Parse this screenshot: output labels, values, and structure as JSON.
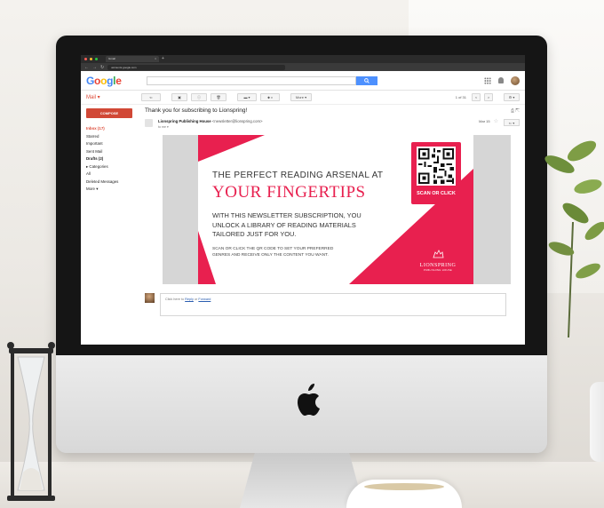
{
  "browser": {
    "tab_title": "Gmail",
    "tab_close": "×",
    "new_tab": "+",
    "url": "accounts.google.com"
  },
  "gmail": {
    "logo": [
      "G",
      "o",
      "o",
      "g",
      "l",
      "e"
    ],
    "mail_label": "Mail ▾",
    "toolbar": {
      "back": "⇐",
      "archive": "▣",
      "spam": "ⓘ",
      "delete": "🗑",
      "move": "▬ ▾",
      "labels": "⬥ ▾",
      "more": "More ▾",
      "page_count": "1 of 31",
      "prev": "<",
      "next": ">",
      "settings": "⚙ ▾"
    },
    "sidebar": {
      "compose": "COMPOSE",
      "items": [
        {
          "label": "Inbox (17)"
        },
        {
          "label": "Starred"
        },
        {
          "label": "Important"
        },
        {
          "label": "Sent Mail"
        },
        {
          "label": "Drafts (2)"
        },
        {
          "label": "▸ Categories"
        },
        {
          "label": "All"
        },
        {
          "label": "Deleted Messages"
        },
        {
          "label": "More ▾"
        }
      ]
    },
    "message": {
      "subject": "Thank you for subscribing to Lionspring!",
      "subject_icons": "⎙ ⇱",
      "sender_name": "Lionspring Publishing House",
      "sender_email": "<newsletter@lionspring.com>",
      "to": "to me ▾",
      "date": "Mar 15",
      "star": "☆",
      "reply": "⇐ ▾"
    },
    "reply": {
      "prompt_pre": "Click here to ",
      "reply_link": "Reply",
      "or": " or ",
      "forward_link": "Forward"
    }
  },
  "newsletter": {
    "headline_line1": "THE PERFECT READING ARSENAL AT",
    "headline_line2": "YOUR FINGERTIPS",
    "body_line1": "WITH THIS NEWSLETTER SUBSCRIPTION, YOU",
    "body_line2": "UNLOCK A LIBRARY OF READING MATERIALS",
    "body_line3": "TAILORED JUST FOR YOU.",
    "small_line1": "SCAN OR CLICK THE QR CODE TO SET YOUR PREFERRED",
    "small_line2": "GENRES AND RECEIVE ONLY THE CONTENT YOU WANT.",
    "qr_label": "SCAN OR CLICK",
    "brand_name": "LIONSPRING",
    "brand_sub": "PUBLISHING HOUSE",
    "accent": "#e8204f"
  }
}
